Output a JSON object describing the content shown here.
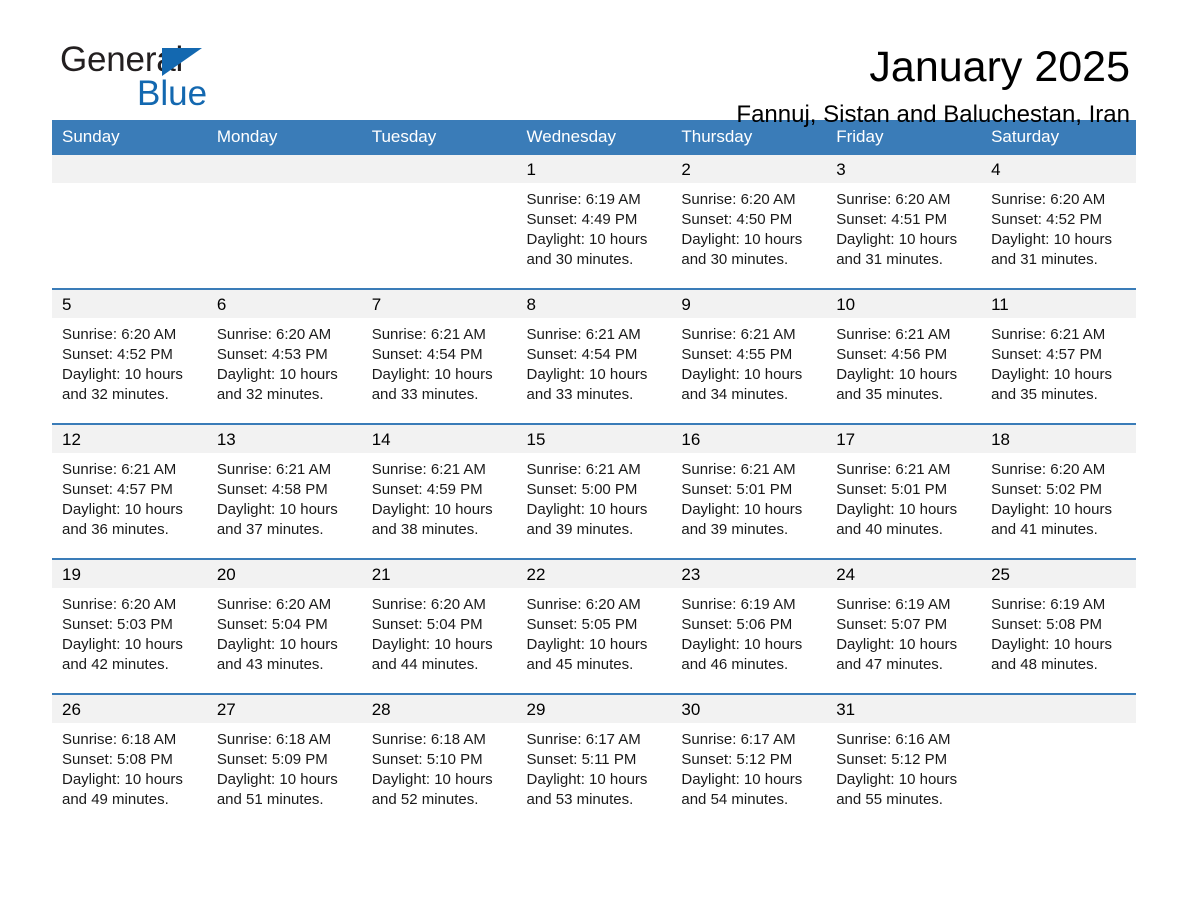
{
  "brand": {
    "word1": "General",
    "word2": "Blue",
    "triangle_color": "#1368b0",
    "text_color": "#231f20"
  },
  "header": {
    "month_title": "January 2025",
    "location": "Fannuj, Sistan and Baluchestan, Iran"
  },
  "theme": {
    "header_bg": "#3a7cb8",
    "header_text": "#ffffff",
    "daynum_band_bg": "#f2f2f2",
    "row_border": "#3a7cb8",
    "cell_bg": "#ffffff"
  },
  "calendar": {
    "weekday_headers": [
      "Sunday",
      "Monday",
      "Tuesday",
      "Wednesday",
      "Thursday",
      "Friday",
      "Saturday"
    ],
    "weeks": [
      [
        {
          "day": "",
          "lines": []
        },
        {
          "day": "",
          "lines": []
        },
        {
          "day": "",
          "lines": []
        },
        {
          "day": "1",
          "lines": [
            "Sunrise: 6:19 AM",
            "Sunset: 4:49 PM",
            "Daylight: 10 hours",
            "and 30 minutes."
          ]
        },
        {
          "day": "2",
          "lines": [
            "Sunrise: 6:20 AM",
            "Sunset: 4:50 PM",
            "Daylight: 10 hours",
            "and 30 minutes."
          ]
        },
        {
          "day": "3",
          "lines": [
            "Sunrise: 6:20 AM",
            "Sunset: 4:51 PM",
            "Daylight: 10 hours",
            "and 31 minutes."
          ]
        },
        {
          "day": "4",
          "lines": [
            "Sunrise: 6:20 AM",
            "Sunset: 4:52 PM",
            "Daylight: 10 hours",
            "and 31 minutes."
          ]
        }
      ],
      [
        {
          "day": "5",
          "lines": [
            "Sunrise: 6:20 AM",
            "Sunset: 4:52 PM",
            "Daylight: 10 hours",
            "and 32 minutes."
          ]
        },
        {
          "day": "6",
          "lines": [
            "Sunrise: 6:20 AM",
            "Sunset: 4:53 PM",
            "Daylight: 10 hours",
            "and 32 minutes."
          ]
        },
        {
          "day": "7",
          "lines": [
            "Sunrise: 6:21 AM",
            "Sunset: 4:54 PM",
            "Daylight: 10 hours",
            "and 33 minutes."
          ]
        },
        {
          "day": "8",
          "lines": [
            "Sunrise: 6:21 AM",
            "Sunset: 4:54 PM",
            "Daylight: 10 hours",
            "and 33 minutes."
          ]
        },
        {
          "day": "9",
          "lines": [
            "Sunrise: 6:21 AM",
            "Sunset: 4:55 PM",
            "Daylight: 10 hours",
            "and 34 minutes."
          ]
        },
        {
          "day": "10",
          "lines": [
            "Sunrise: 6:21 AM",
            "Sunset: 4:56 PM",
            "Daylight: 10 hours",
            "and 35 minutes."
          ]
        },
        {
          "day": "11",
          "lines": [
            "Sunrise: 6:21 AM",
            "Sunset: 4:57 PM",
            "Daylight: 10 hours",
            "and 35 minutes."
          ]
        }
      ],
      [
        {
          "day": "12",
          "lines": [
            "Sunrise: 6:21 AM",
            "Sunset: 4:57 PM",
            "Daylight: 10 hours",
            "and 36 minutes."
          ]
        },
        {
          "day": "13",
          "lines": [
            "Sunrise: 6:21 AM",
            "Sunset: 4:58 PM",
            "Daylight: 10 hours",
            "and 37 minutes."
          ]
        },
        {
          "day": "14",
          "lines": [
            "Sunrise: 6:21 AM",
            "Sunset: 4:59 PM",
            "Daylight: 10 hours",
            "and 38 minutes."
          ]
        },
        {
          "day": "15",
          "lines": [
            "Sunrise: 6:21 AM",
            "Sunset: 5:00 PM",
            "Daylight: 10 hours",
            "and 39 minutes."
          ]
        },
        {
          "day": "16",
          "lines": [
            "Sunrise: 6:21 AM",
            "Sunset: 5:01 PM",
            "Daylight: 10 hours",
            "and 39 minutes."
          ]
        },
        {
          "day": "17",
          "lines": [
            "Sunrise: 6:21 AM",
            "Sunset: 5:01 PM",
            "Daylight: 10 hours",
            "and 40 minutes."
          ]
        },
        {
          "day": "18",
          "lines": [
            "Sunrise: 6:20 AM",
            "Sunset: 5:02 PM",
            "Daylight: 10 hours",
            "and 41 minutes."
          ]
        }
      ],
      [
        {
          "day": "19",
          "lines": [
            "Sunrise: 6:20 AM",
            "Sunset: 5:03 PM",
            "Daylight: 10 hours",
            "and 42 minutes."
          ]
        },
        {
          "day": "20",
          "lines": [
            "Sunrise: 6:20 AM",
            "Sunset: 5:04 PM",
            "Daylight: 10 hours",
            "and 43 minutes."
          ]
        },
        {
          "day": "21",
          "lines": [
            "Sunrise: 6:20 AM",
            "Sunset: 5:04 PM",
            "Daylight: 10 hours",
            "and 44 minutes."
          ]
        },
        {
          "day": "22",
          "lines": [
            "Sunrise: 6:20 AM",
            "Sunset: 5:05 PM",
            "Daylight: 10 hours",
            "and 45 minutes."
          ]
        },
        {
          "day": "23",
          "lines": [
            "Sunrise: 6:19 AM",
            "Sunset: 5:06 PM",
            "Daylight: 10 hours",
            "and 46 minutes."
          ]
        },
        {
          "day": "24",
          "lines": [
            "Sunrise: 6:19 AM",
            "Sunset: 5:07 PM",
            "Daylight: 10 hours",
            "and 47 minutes."
          ]
        },
        {
          "day": "25",
          "lines": [
            "Sunrise: 6:19 AM",
            "Sunset: 5:08 PM",
            "Daylight: 10 hours",
            "and 48 minutes."
          ]
        }
      ],
      [
        {
          "day": "26",
          "lines": [
            "Sunrise: 6:18 AM",
            "Sunset: 5:08 PM",
            "Daylight: 10 hours",
            "and 49 minutes."
          ]
        },
        {
          "day": "27",
          "lines": [
            "Sunrise: 6:18 AM",
            "Sunset: 5:09 PM",
            "Daylight: 10 hours",
            "and 51 minutes."
          ]
        },
        {
          "day": "28",
          "lines": [
            "Sunrise: 6:18 AM",
            "Sunset: 5:10 PM",
            "Daylight: 10 hours",
            "and 52 minutes."
          ]
        },
        {
          "day": "29",
          "lines": [
            "Sunrise: 6:17 AM",
            "Sunset: 5:11 PM",
            "Daylight: 10 hours",
            "and 53 minutes."
          ]
        },
        {
          "day": "30",
          "lines": [
            "Sunrise: 6:17 AM",
            "Sunset: 5:12 PM",
            "Daylight: 10 hours",
            "and 54 minutes."
          ]
        },
        {
          "day": "31",
          "lines": [
            "Sunrise: 6:16 AM",
            "Sunset: 5:12 PM",
            "Daylight: 10 hours",
            "and 55 minutes."
          ]
        },
        {
          "day": "",
          "lines": []
        }
      ]
    ]
  }
}
